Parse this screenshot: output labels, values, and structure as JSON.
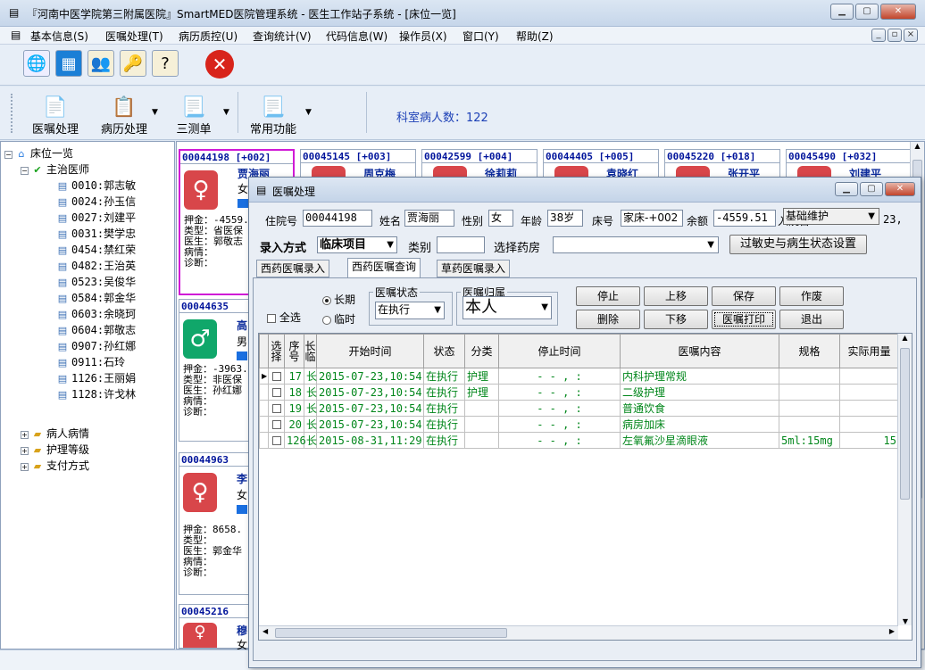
{
  "window": {
    "title": "『河南中医学院第三附属医院』SmartMED医院管理系统 - 医生工作站子系统 - [床位一览]"
  },
  "menu": [
    "基本信息(S)",
    "医嘱处理(T)",
    "病历质控(U)",
    "查询统计(V)",
    "代码信息(W)",
    "操作员(X)",
    "窗口(Y)",
    "帮助(Z)"
  ],
  "toolbar2": {
    "buttons": [
      "医嘱处理",
      "病历处理",
      "三测单",
      "常用功能"
    ],
    "dept_count_label": "科室病人数：122"
  },
  "tree": {
    "root": "床位一览",
    "doctors_label": "主治医师",
    "doctors": [
      "0010:郭志敏",
      "0024:孙玉信",
      "0027:刘建平",
      "0031:樊学忠",
      "0454:禁红荣",
      "0482:王治英",
      "0523:吴俊华",
      "0584:郭金华",
      "0603:余晓珂",
      "0604:郭敬志",
      "0907:孙红娜",
      "0911:石玲",
      "1126:王丽娟",
      "1128:许戈林"
    ],
    "groups": [
      "病人病情",
      "护理等级",
      "支付方式"
    ]
  },
  "cards": [
    {
      "header": "00044198 [+002]",
      "name": "贾海丽",
      "gender": "女",
      "deposit": "押金：-4559.",
      "type": "类型：省医保",
      "doctor": "医生：郭敬志",
      "condition": "病情：",
      "diagnosis": "诊断："
    },
    {
      "header": "00045145 [+003]",
      "name": "周克梅"
    },
    {
      "header": "00042599 [+004]",
      "name": "徐莉莉"
    },
    {
      "header": "00044405 [+005]",
      "name": "袁晓红"
    },
    {
      "header": "00045220 [+018]",
      "name": "张开平"
    },
    {
      "header": "00045490 [+032]",
      "name": "刘建平"
    },
    {
      "header": "00044635",
      "name": "高",
      "gender": "男",
      "deposit": "押金：-3963.",
      "type": "类型：非医保",
      "doctor": "医生：孙红娜",
      "condition": "病情：",
      "diagnosis": "诊断："
    },
    {
      "header": "00044963",
      "name": "李",
      "gender": "女",
      "deposit": "押金：8658.",
      "type": "类型：",
      "doctor": "医生：郭金华",
      "condition": "病情：",
      "diagnosis": "诊断："
    },
    {
      "header": "00045216",
      "name": "穆",
      "gender": "女"
    }
  ],
  "dialog": {
    "title": "医嘱处理",
    "patient": {
      "id_label": "住院号",
      "id": "00044198",
      "name_label": "姓名",
      "name": "贾海丽",
      "sex_label": "性别",
      "sex": "女",
      "age_label": "年龄",
      "age": "38岁",
      "bed_label": "床号",
      "bed": "家床-+002",
      "balance_label": "余额",
      "balance": "-4559.51",
      "admit_label": "入院日",
      "admit_tail": "23,",
      "maint_select": "基础维护"
    },
    "entry_mode_label": "录入方式",
    "entry_mode": "临床项目",
    "category_label": "类别",
    "category": "",
    "pharmacy_label": "选择药房",
    "pharmacy": "",
    "allergy_button": "过敏史与病生状态设置",
    "tabs": [
      "西药医嘱录入",
      "西药医嘱查询",
      "草药医嘱录入"
    ],
    "select_all": "全选",
    "long_term": "长期",
    "temporary": "临时",
    "order_status_group": "医嘱状态",
    "order_status": "在执行",
    "order_owner_group": "医嘱归属",
    "order_owner": "本人",
    "buttons": {
      "stop": "停止",
      "delete": "删除",
      "up": "上移",
      "down": "下移",
      "save": "保存",
      "print": "医嘱打印",
      "void": "作废",
      "exit": "退出"
    },
    "columns": [
      "选择",
      "序号",
      "长临",
      "开始时间",
      "状态",
      "分类",
      "停止时间",
      "医嘱内容",
      "规格",
      "实际用量"
    ],
    "rows": [
      {
        "seq": "17",
        "type": "长",
        "start": "2015-07-23,10:54",
        "status": "在执行",
        "cat": "护理",
        "stop": "-  -  ,  :",
        "content": "内科护理常规",
        "spec": "",
        "qty": ""
      },
      {
        "seq": "18",
        "type": "长",
        "start": "2015-07-23,10:54",
        "status": "在执行",
        "cat": "护理",
        "stop": "-  -  ,  :",
        "content": "二级护理",
        "spec": "",
        "qty": ""
      },
      {
        "seq": "19",
        "type": "长",
        "start": "2015-07-23,10:54",
        "status": "在执行",
        "cat": "",
        "stop": "-  -  ,  :",
        "content": "普通饮食",
        "spec": "",
        "qty": ""
      },
      {
        "seq": "20",
        "type": "长",
        "start": "2015-07-23,10:54",
        "status": "在执行",
        "cat": "",
        "stop": "-  -  ,  :",
        "content": "病房加床",
        "spec": "",
        "qty": ""
      },
      {
        "seq": "126",
        "type": "长",
        "start": "2015-08-31,11:29",
        "status": "在执行",
        "cat": "",
        "stop": "-  -  ,  :",
        "content": "左氧氟沙星滴眼液",
        "spec": "5ml:15mg",
        "qty": "15"
      }
    ]
  }
}
